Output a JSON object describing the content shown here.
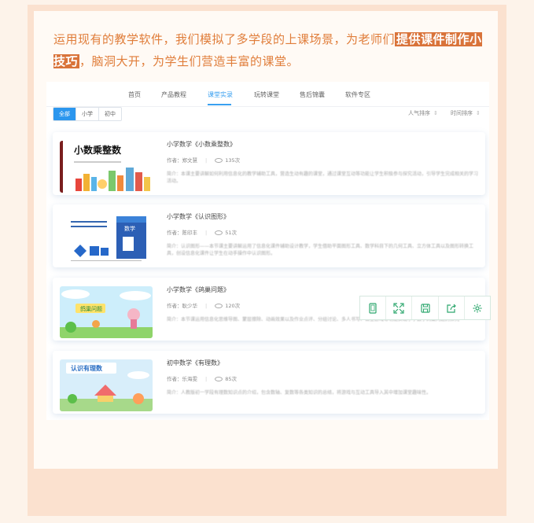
{
  "intro": {
    "text_before": "运用现有的教学软件，我们模拟了多学段的上课场景，为老师们",
    "highlight": "提供课件制作小技巧",
    "text_after": "，脑洞大开，为学生们营造丰富的课堂。"
  },
  "nav": {
    "items": [
      "首页",
      "产品教程",
      "课堂实录",
      "玩转课堂",
      "售后锦囊",
      "软件专区"
    ],
    "active_index": 2
  },
  "filters": [
    "全部",
    "小学",
    "初中"
  ],
  "sort": [
    "人气排序",
    "时间排序"
  ],
  "courses": [
    {
      "title": "小学数学《小数乘整数》",
      "author_label": "作者",
      "author": "郑文慧",
      "views": "135次",
      "desc": "简介：本课主要讲解如何利用信息化的教学辅助工具，营造生动有趣的课堂，通过课堂互动等功能让学生积极参与探究活动，引导学生完成相关的学习活动。",
      "thumb_text": "小数乘整数"
    },
    {
      "title": "小学数学《认识图形》",
      "author_label": "作者",
      "author": "陈印丰",
      "views": "51次",
      "desc": "简介：认识图形——本节课主要讲解运用了信息化课件辅助设计教学，学生借助平面图形工具、数学科目下的几何工具、立方体工具以及图形转换工具，创设信息化课件让学生在动手操作中认识图形。",
      "thumb_text": "数学"
    },
    {
      "title": "小学数学《鸽巢问题》",
      "author_label": "作者",
      "author": "耿少华",
      "views": "120次",
      "desc": "简介：本节课运用信息化思维导图、蒙层擦除、动画效果以及作业点评、分组讨论、多人书写、课堂游戏等功能实现小学数学鸽巢问题的探究",
      "thumb_text": "鸽巢问题"
    },
    {
      "title": "初中数学《有理数》",
      "author_label": "作者",
      "author": "乐海雯",
      "views": "85次",
      "desc": "简介：人教版初一学段有理数知识点的介绍，包含数轴、复数等各类知识的总结，将游戏与互动工具导入其中增加课堂趣味性。",
      "thumb_text": "认识有理数"
    }
  ],
  "toolbar_icons": [
    "tablet-icon",
    "fullscreen-icon",
    "save-icon",
    "share-icon",
    "settings-icon"
  ],
  "colors": {
    "accent": "#3aa0f0",
    "highlight_bg": "#d9733a",
    "intro_text": "#e07d3a",
    "tool_icon": "#2fa86f"
  }
}
